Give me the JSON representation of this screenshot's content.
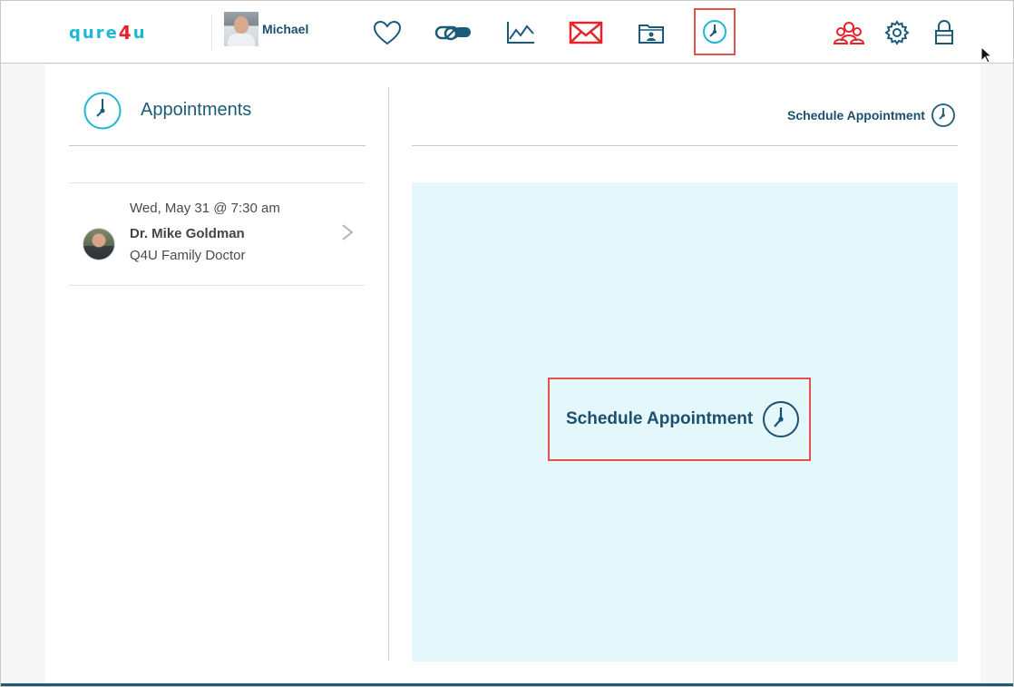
{
  "header": {
    "logo": {
      "left": "qure",
      "mid": "4",
      "right": "u"
    },
    "user_name": "Michael",
    "nav_icons": [
      "heart-icon",
      "pills-icon",
      "chart-line-icon",
      "mail-icon",
      "records-folder-icon",
      "clock-icon"
    ],
    "right_icons": [
      "family-icon",
      "gear-icon",
      "lock-icon"
    ]
  },
  "page": {
    "title": "Appointments",
    "schedule_link": "Schedule Appointment"
  },
  "appointments": [
    {
      "date": "Wed, May 31 @ 7:30 am",
      "doctor": "Dr. Mike Goldman",
      "role": "Q4U Family Doctor"
    }
  ],
  "main": {
    "schedule_button": "Schedule Appointment"
  },
  "colors": {
    "brand_blue": "#1d5a7a",
    "accent_cyan": "#1fb8d4",
    "alert_red": "#e3242b",
    "panel_bg": "#e4f7fb",
    "highlight_border": "#e2524c"
  }
}
